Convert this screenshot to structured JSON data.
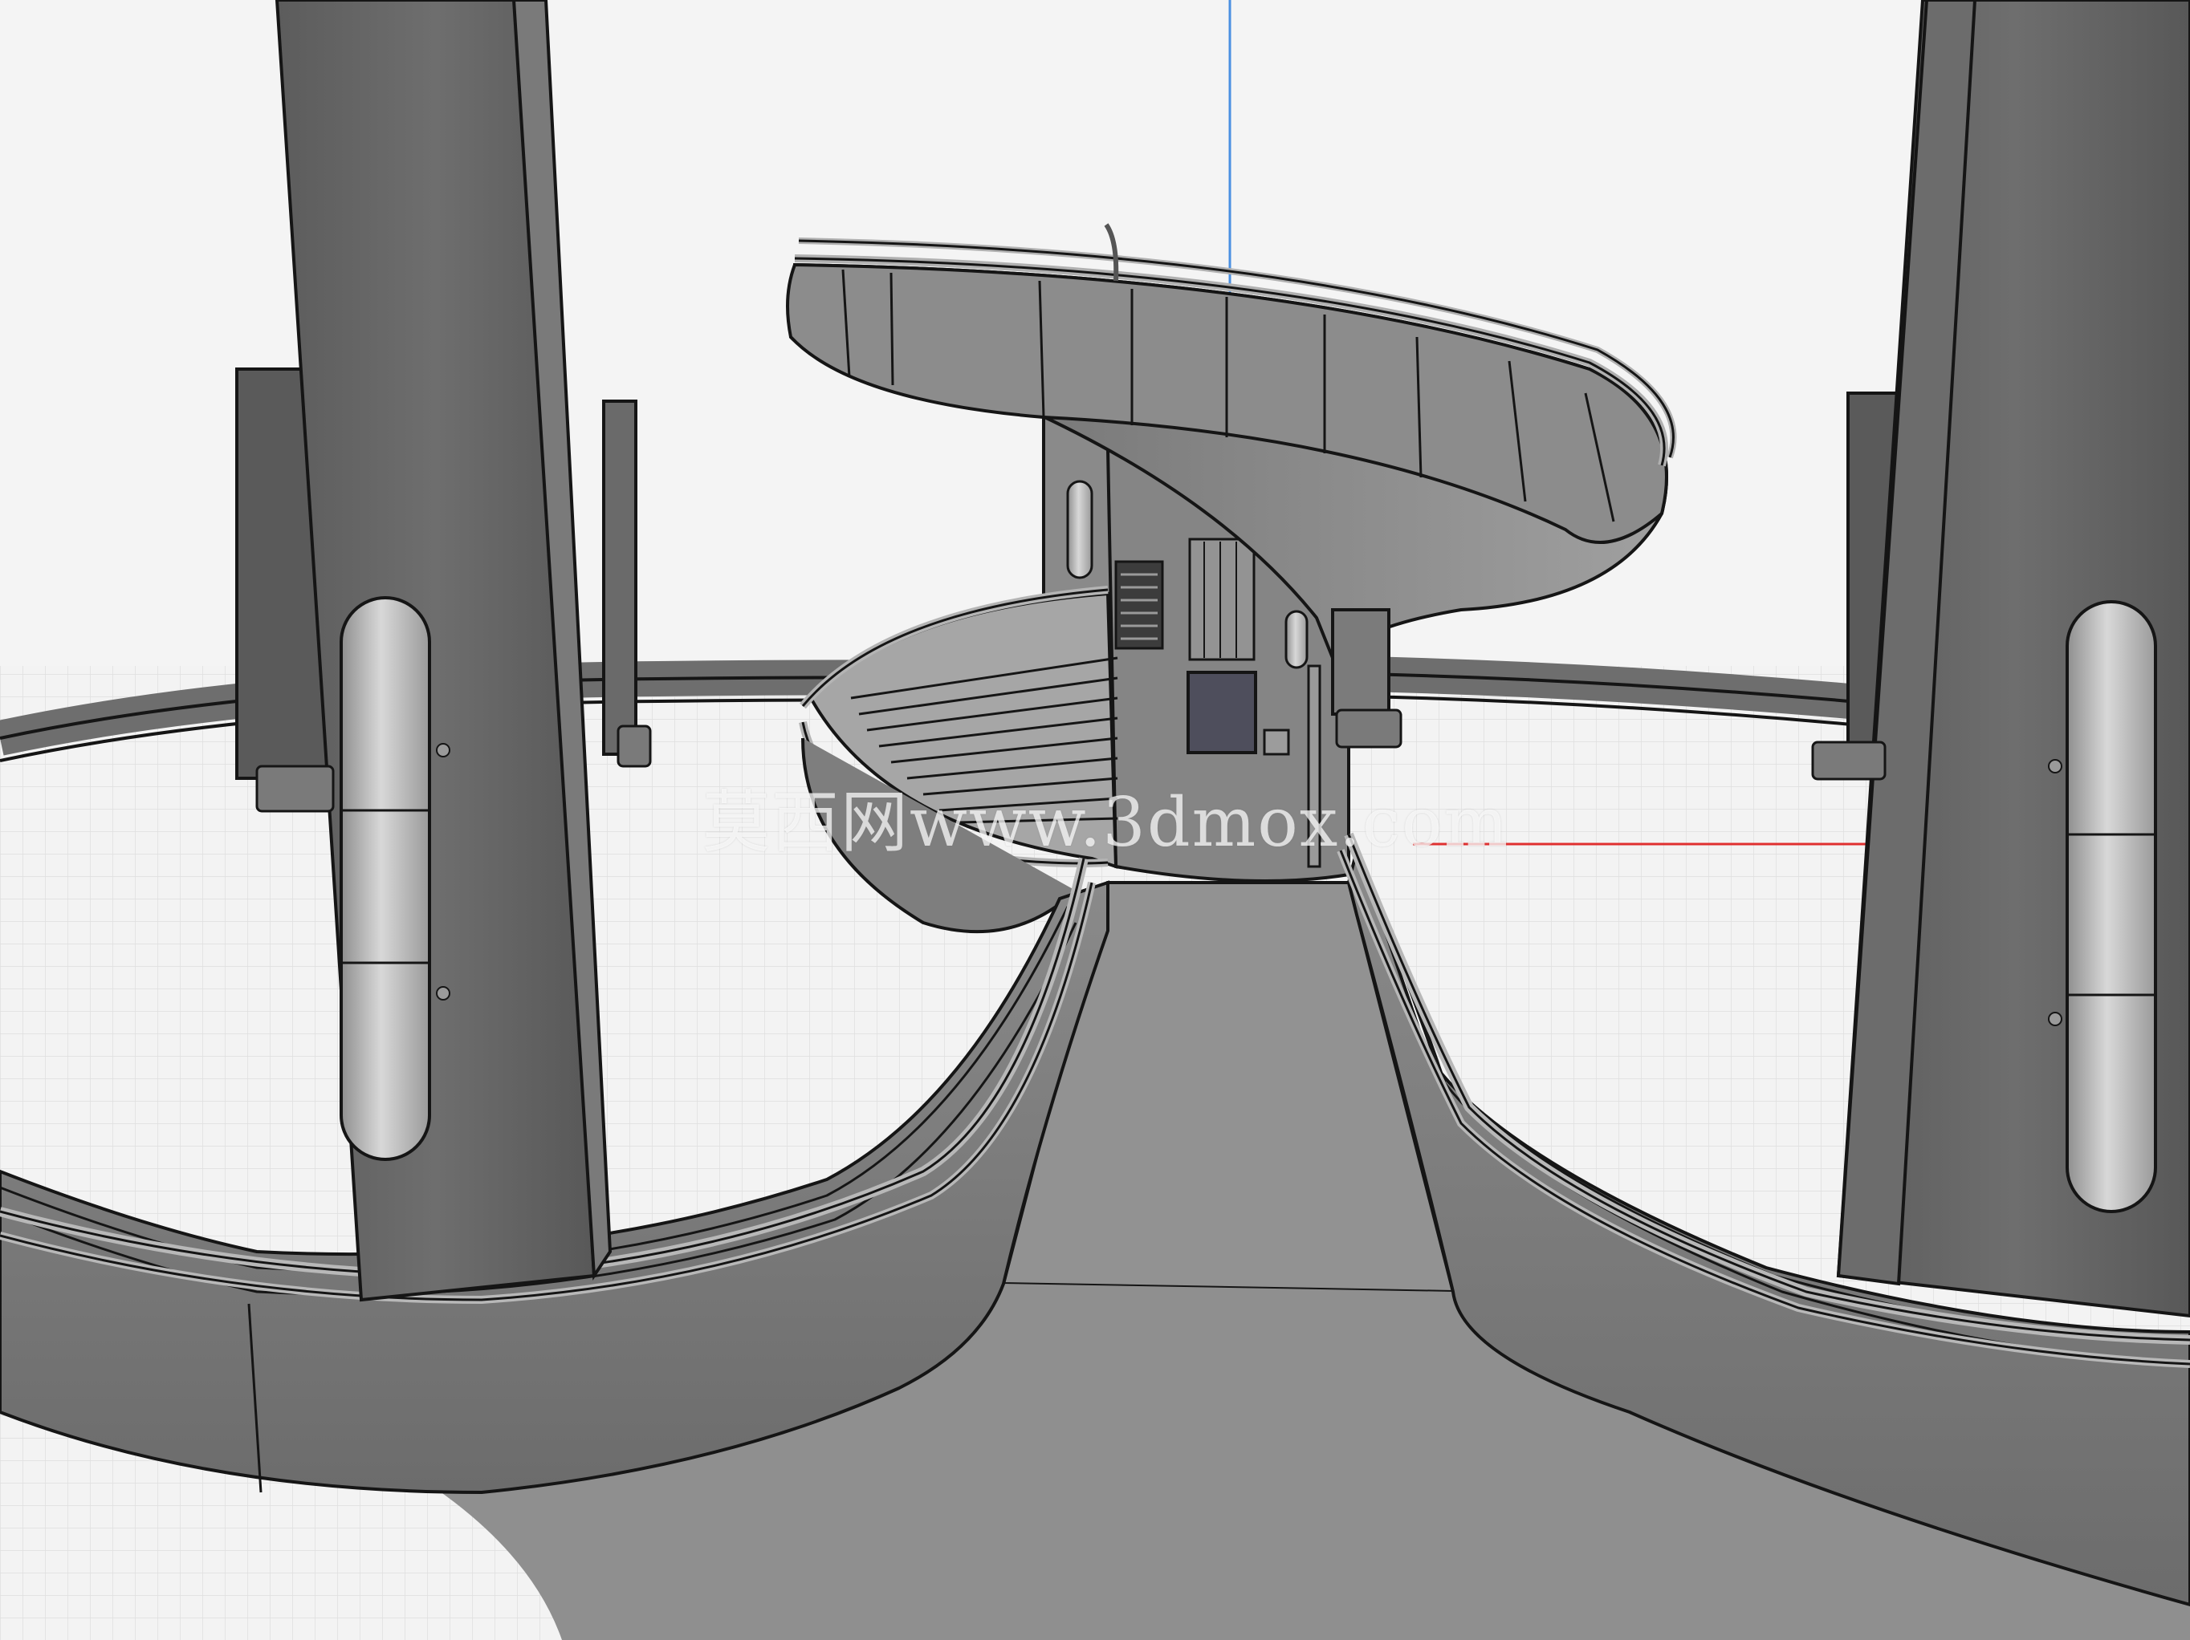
{
  "scene": {
    "watermark_text": "莫西网www.3dmox.com",
    "colors": {
      "background": "#f4f4f4",
      "grid_line": "#d2d2d2",
      "surface_light": "#9a9a9a",
      "surface_mid": "#7d7d7d",
      "surface_dark": "#5e5e5e",
      "edge": "#151515",
      "z_axis": "#4a90e2",
      "x_axis": "#e03030",
      "panel_dark": "#4e4e5c"
    },
    "icons": [
      "z-axis-line",
      "x-axis-line",
      "origin-gizmo"
    ]
  }
}
